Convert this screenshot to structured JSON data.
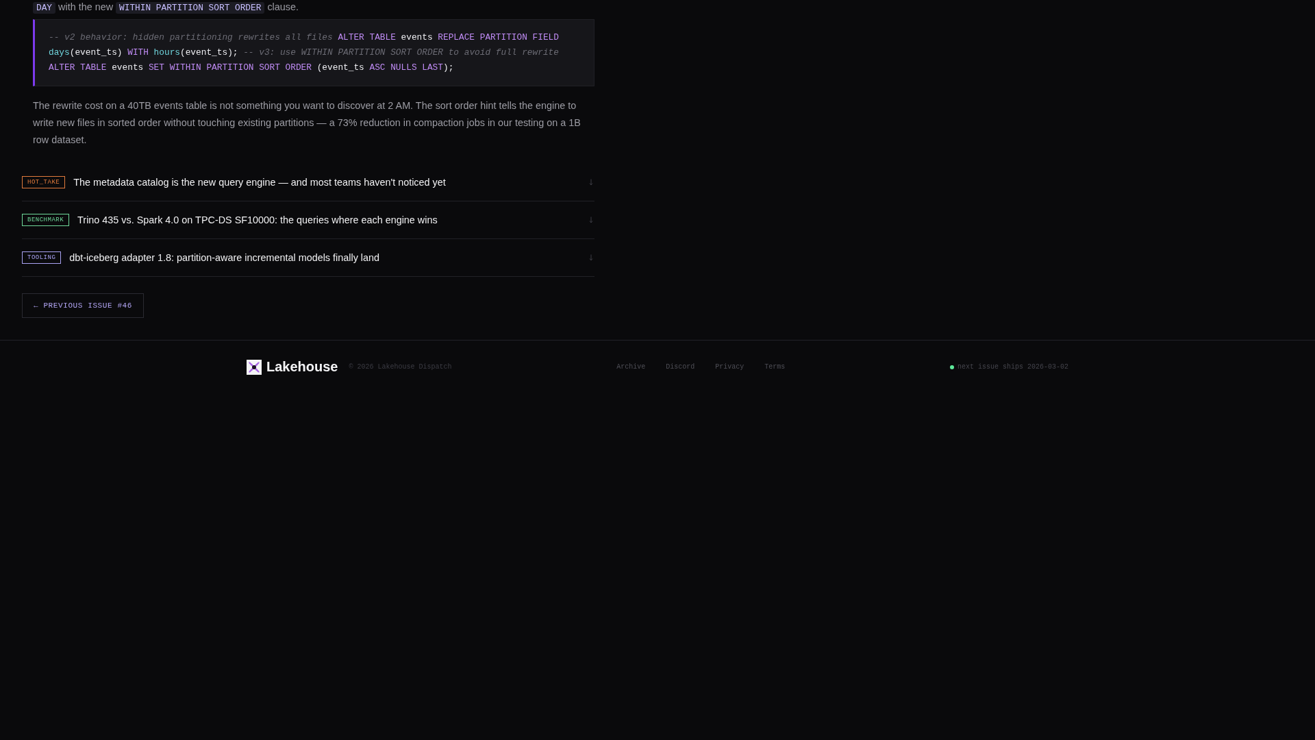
{
  "article": {
    "lead_in": [
      {
        "kind": "code",
        "text": "DAY"
      },
      {
        "kind": "text",
        "text": " with the new "
      },
      {
        "kind": "code",
        "text": "WITHIN PARTITION SORT ORDER"
      },
      {
        "kind": "text",
        "text": " clause."
      }
    ],
    "code_block": [
      {
        "kind": "comment",
        "text": "-- v2 behavior: hidden partitioning rewrites all files "
      },
      {
        "kind": "keyword",
        "text": "ALTER TABLE"
      },
      {
        "kind": "plain",
        "text": " events "
      },
      {
        "kind": "keyword",
        "text": "REPLACE PARTITION FIELD "
      },
      {
        "kind": "function",
        "text": "days"
      },
      {
        "kind": "plain",
        "text": "(event_ts) "
      },
      {
        "kind": "keyword",
        "text": "WITH "
      },
      {
        "kind": "function",
        "text": "hours"
      },
      {
        "kind": "plain",
        "text": "(event_ts); "
      },
      {
        "kind": "comment",
        "text": "-- v3: use WITHIN PARTITION SORT ORDER to avoid full rewrite "
      },
      {
        "kind": "keyword",
        "text": "ALTER TABLE"
      },
      {
        "kind": "plain",
        "text": " events "
      },
      {
        "kind": "keyword",
        "text": "SET WITHIN PARTITION SORT ORDER"
      },
      {
        "kind": "plain",
        "text": " (event_ts "
      },
      {
        "kind": "keyword",
        "text": "ASC NULLS LAST"
      },
      {
        "kind": "plain",
        "text": ");"
      }
    ],
    "paragraph": "The rewrite cost on a 40TB events table is not something you want to discover at 2 AM. The sort order hint tells the engine to write new files in sorted order without touching existing partitions — a 73% reduction in compaction jobs in our testing on a 1B row dataset."
  },
  "related_posts": [
    {
      "tag": "HOT_TAKE",
      "color": "#e07a3c",
      "title": "The metadata catalog is the new query engine — and most teams haven't noticed yet"
    },
    {
      "tag": "BENCHMARK",
      "color": "#6fd99a",
      "title": "Trino 435 vs. Spark 4.0 on TPC-DS SF10000: the queries where each engine wins"
    },
    {
      "tag": "TOOLING",
      "color": "#a9a2f2",
      "title": "dbt-iceberg adapter 1.8: partition-aware incremental models finally land"
    }
  ],
  "previous_issue_button": "← PREVIOUS ISSUE #46",
  "footer": {
    "brand": "Lakehouse",
    "copyright": "© 2026 Lakehouse Dispatch",
    "links": [
      "Archive",
      "Discord",
      "Privacy",
      "Terms"
    ],
    "status": "next issue ships 2026-03-02"
  }
}
